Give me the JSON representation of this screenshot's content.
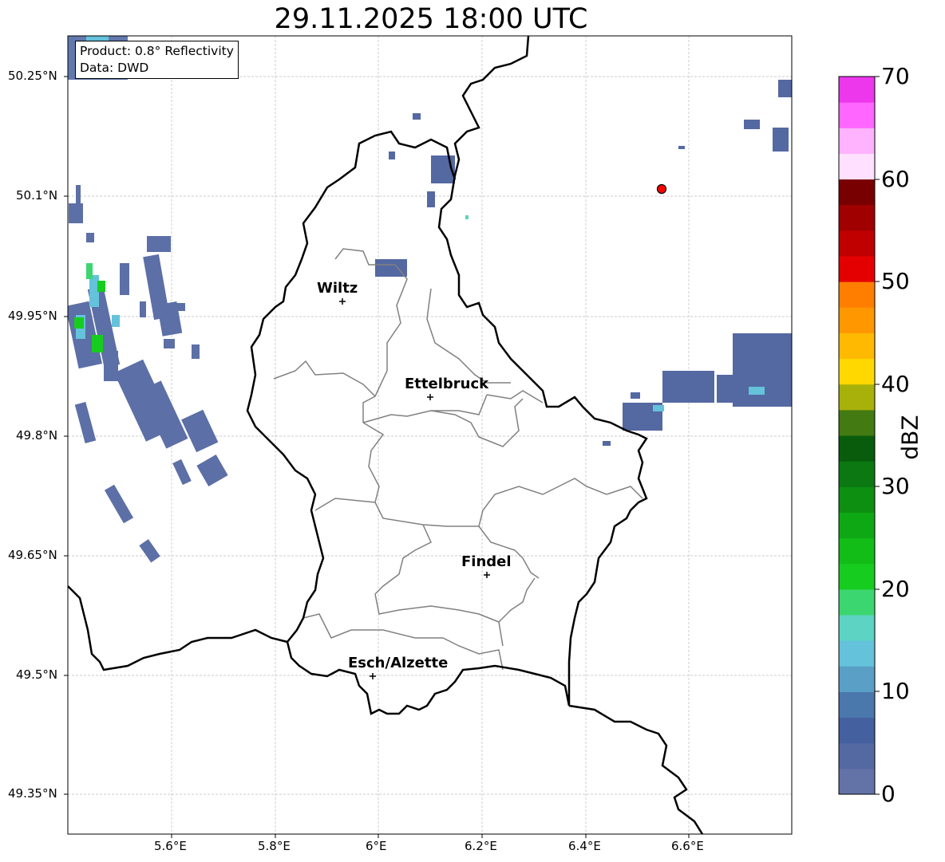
{
  "title": "29.11.2025 18:00 UTC",
  "info": {
    "product": "Product: 0.8° Reflectivity",
    "data": "Data: DWD"
  },
  "axes": {
    "lon_ticks": [
      "5.6°E",
      "5.8°E",
      "6°E",
      "6.2°E",
      "6.4°E",
      "6.6°E"
    ],
    "lat_ticks": [
      "50.25°N",
      "50.1°N",
      "49.95°N",
      "49.8°N",
      "49.65°N",
      "49.5°N",
      "49.35°N"
    ],
    "grid": true
  },
  "colorbar": {
    "label": "dBZ",
    "range": [
      0,
      70
    ],
    "tick_labels": [
      "70",
      "60",
      "50",
      "40",
      "30",
      "20",
      "10",
      "0"
    ],
    "colors": [
      "#6373a8",
      "#5468a2",
      "#44609f",
      "#4a78ad",
      "#5a9fc5",
      "#64c2db",
      "#5cd3c3",
      "#3bd670",
      "#16cc1e",
      "#11bd16",
      "#0fa815",
      "#0d8f12",
      "#0b7812",
      "#095c0c",
      "#437a12",
      "#a8b00a",
      "#ffd800",
      "#ffb900",
      "#ff9800",
      "#ff7e00",
      "#e50000",
      "#c00000",
      "#a00000",
      "#780000",
      "#ffe0ff",
      "#ffb3ff",
      "#ff66ff",
      "#ec37ec"
    ]
  },
  "cities": [
    {
      "name": "Wiltz"
    },
    {
      "name": "Ettelbruck"
    },
    {
      "name": "Findel"
    },
    {
      "name": "Esch/Alzette"
    }
  ],
  "marker": {
    "type": "red-dot",
    "color": "#ff0000"
  }
}
